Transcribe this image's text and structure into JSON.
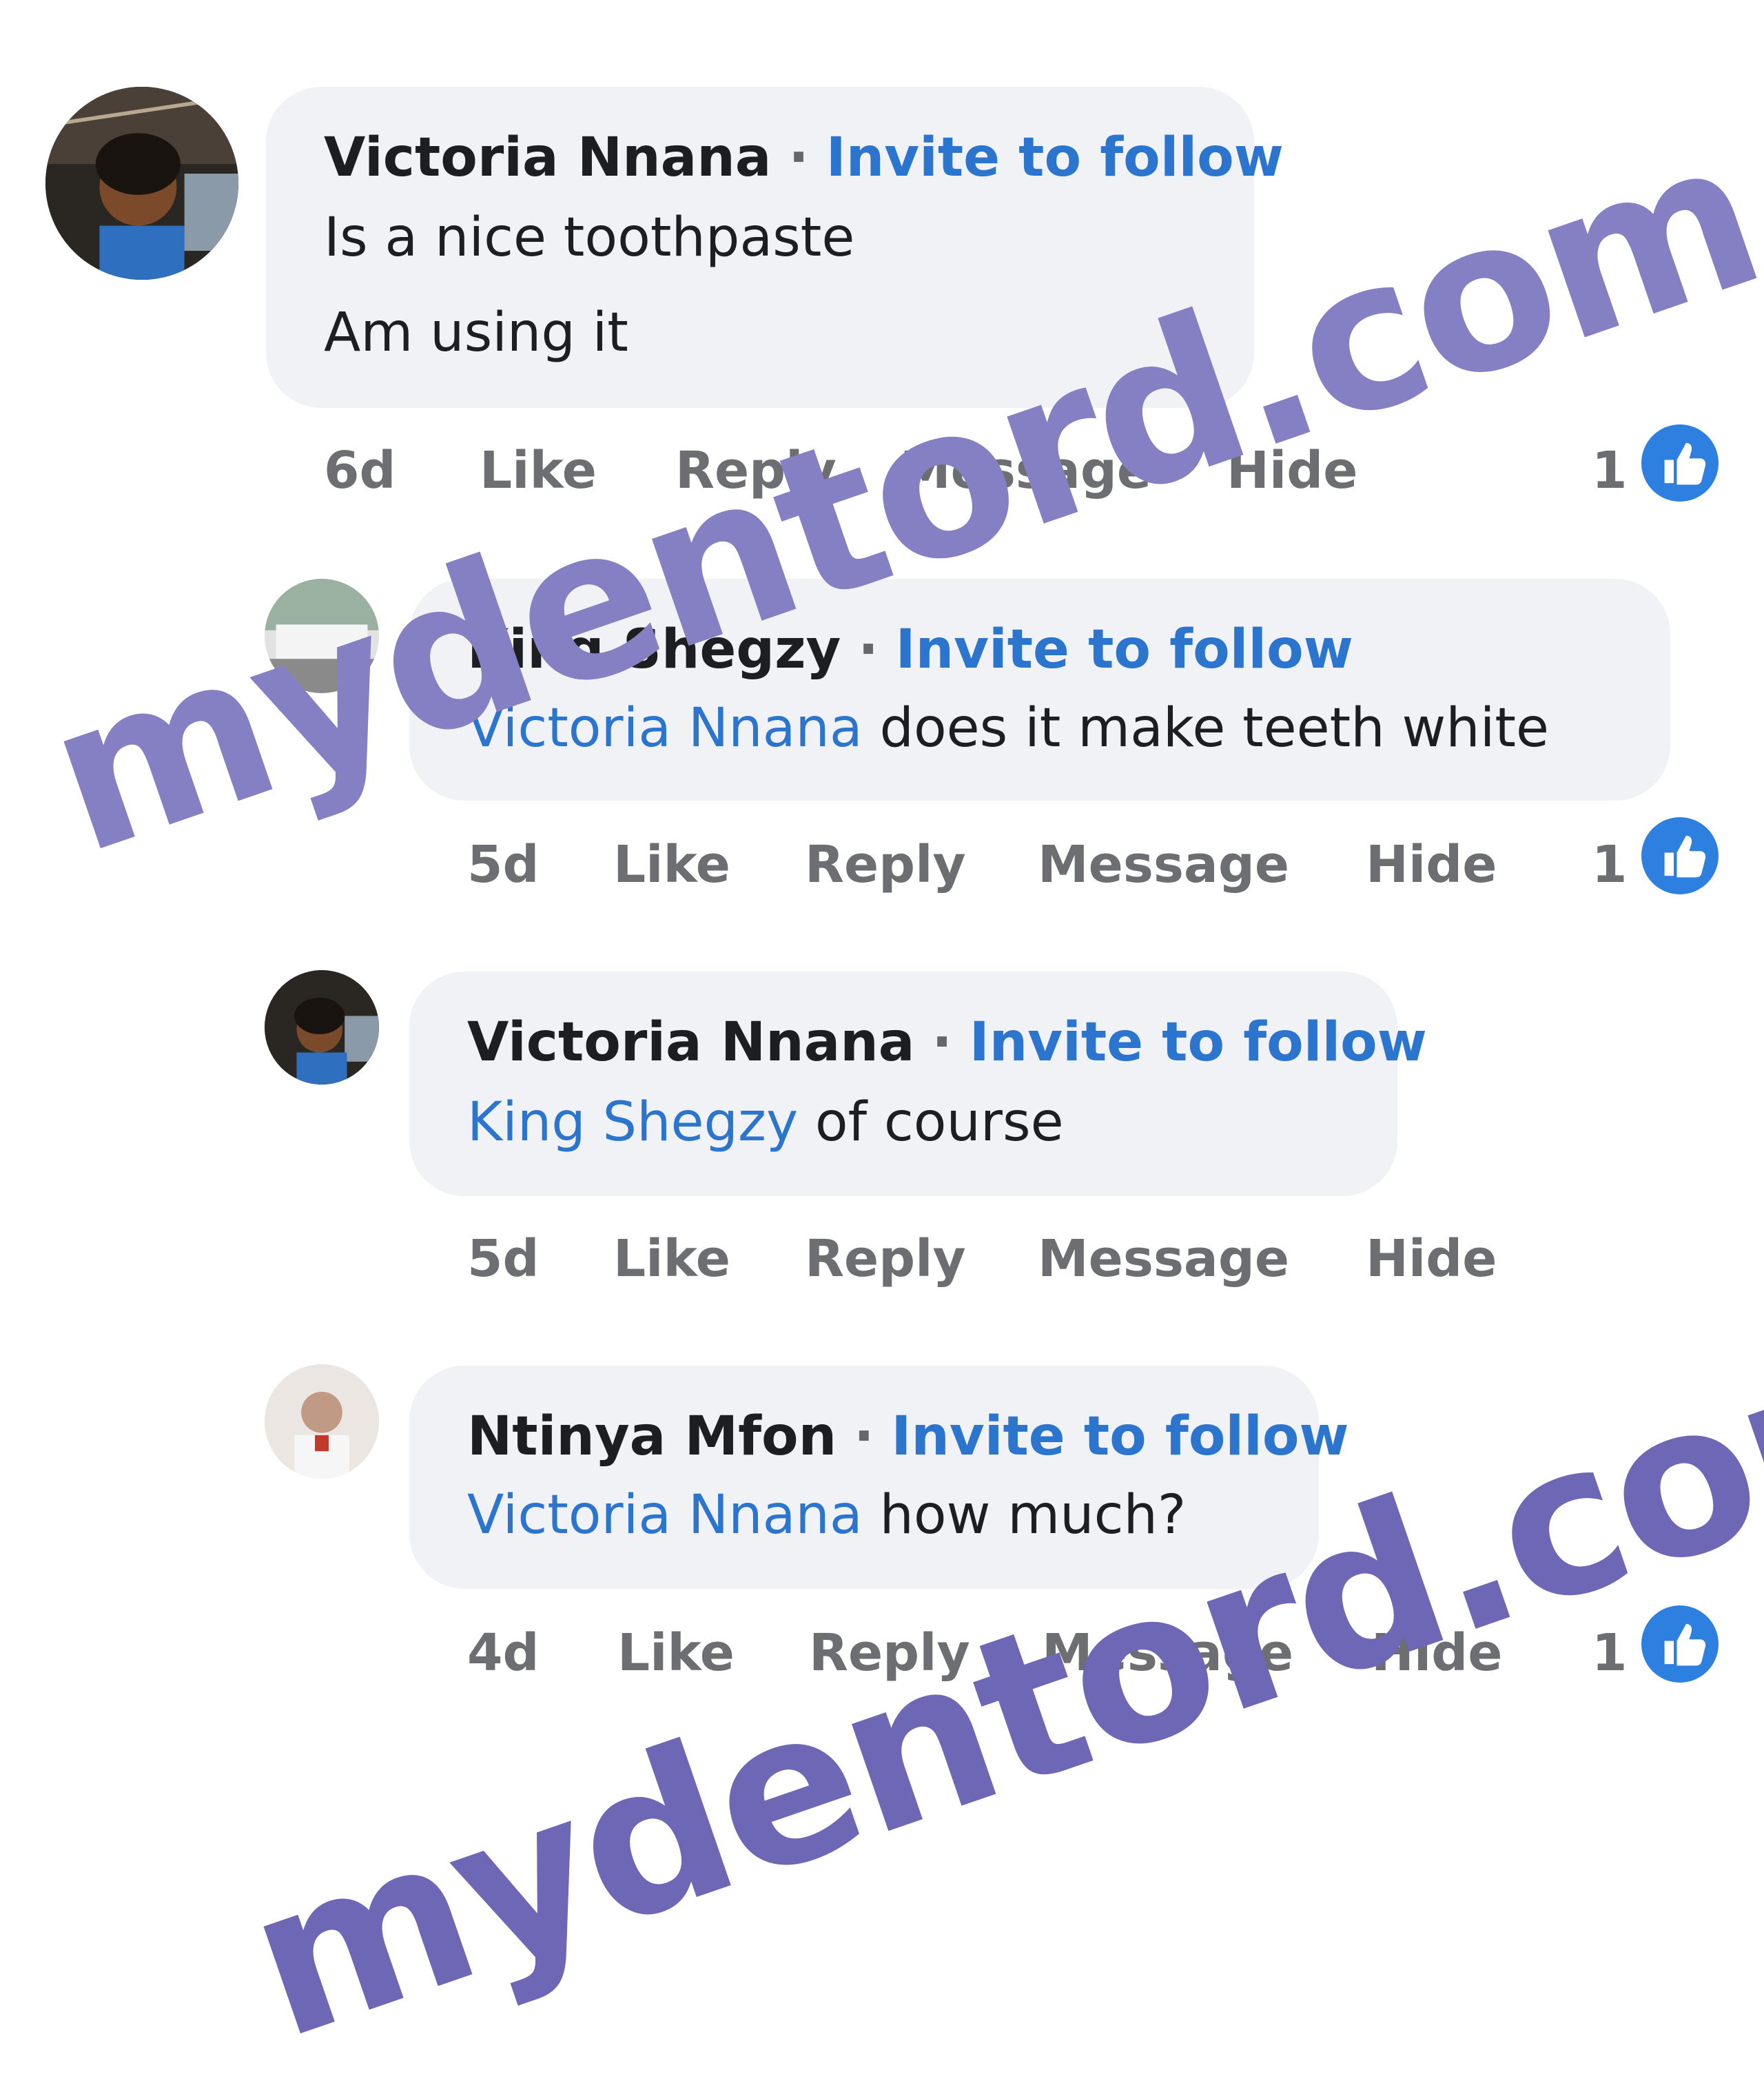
{
  "comments": [
    {
      "author": "Victoria Nnana",
      "separator": "·",
      "invite": "Invite to follow",
      "lines": [
        "Is a nice toothpaste",
        "Am using it"
      ],
      "time": "6d",
      "like": "Like",
      "reply": "Reply",
      "message": "Message",
      "hide": "Hide",
      "reactions": "1",
      "avatar_icon": "profile-photo-woman"
    },
    {
      "author": "King Shegzy",
      "separator": "·",
      "invite": "Invite to follow",
      "mention": "Victoria Nnana",
      "text": " does it make teeth white",
      "time": "5d",
      "like": "Like",
      "reply": "Reply",
      "message": "Message",
      "hide": "Hide",
      "reactions": "1",
      "avatar_icon": "profile-photo-outdoor"
    },
    {
      "author": "Victoria Nnana",
      "separator": "·",
      "invite": "Invite to follow",
      "mention": "King Shegzy",
      "text": " of course",
      "time": "5d",
      "like": "Like",
      "reply": "Reply",
      "message": "Message",
      "hide": "Hide",
      "avatar_icon": "profile-photo-woman"
    },
    {
      "author": "Ntinya Mfon",
      "separator": "·",
      "invite": "Invite to follow",
      "mention": "Victoria Nnana",
      "text": " how much?",
      "time": "4d",
      "like": "Like",
      "reply": "Reply",
      "message": "Message",
      "hide": "Hide",
      "reactions": "1",
      "avatar_icon": "profile-photo-man"
    }
  ],
  "watermark": {
    "text": "mydentord.com",
    "color": "#8580c4"
  },
  "colors": {
    "link": "#2b75cf",
    "bubble": "#f0f2f5",
    "meta": "#6c6e72",
    "like_badge": "#2d7fe0"
  }
}
